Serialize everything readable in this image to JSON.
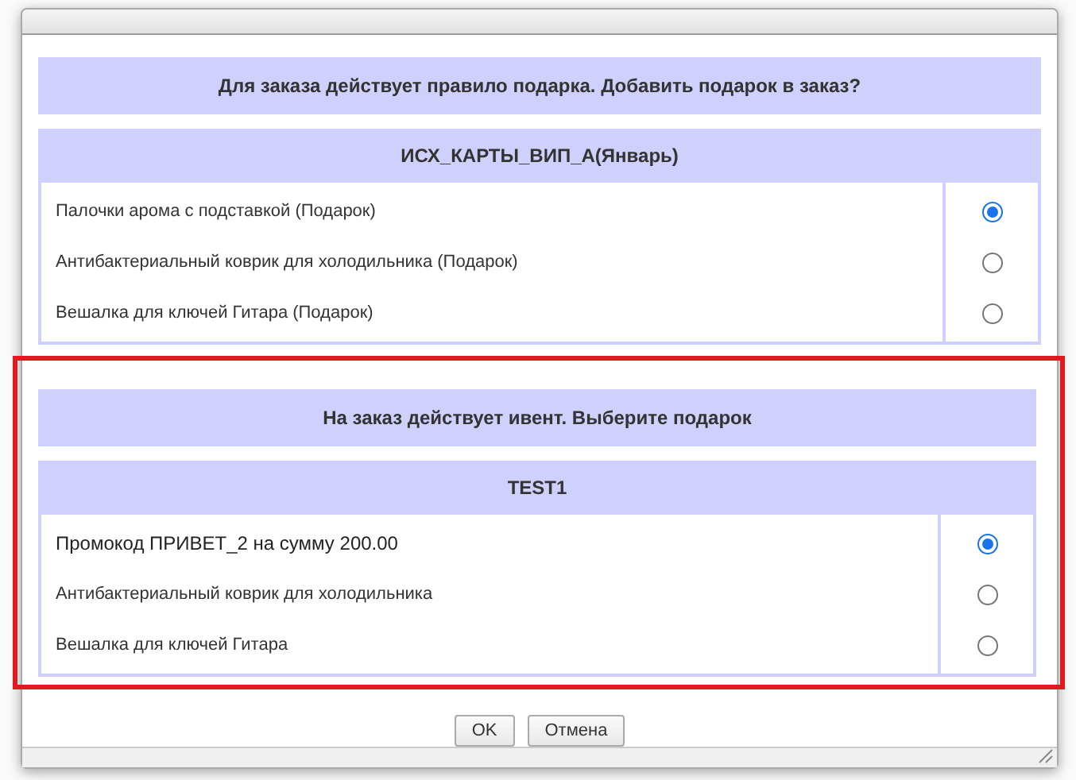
{
  "sections": [
    {
      "prompt": "Для заказа действует правило подарка. Добавить подарок в заказ?",
      "highlighted": false,
      "group": "ИСХ_КАРТЫ_ВИП_А(Январь)",
      "options": [
        {
          "label": "Палочки арома с подставкой (Подарок)",
          "selected": true
        },
        {
          "label": "Антибактериальный коврик для холодильника (Подарок)",
          "selected": false
        },
        {
          "label": "Вешалка для ключей Гитара (Подарок)",
          "selected": false
        }
      ]
    },
    {
      "prompt": "На заказ действует ивент. Выберите подарок",
      "highlighted": true,
      "group": "TEST1",
      "options": [
        {
          "label": "Промокод ПРИВЕТ_2 на сумму 200.00",
          "selected": true
        },
        {
          "label": "Антибактериальный коврик для холодильника",
          "selected": false
        },
        {
          "label": "Вешалка для ключей Гитара",
          "selected": false
        }
      ]
    }
  ],
  "buttons": [
    "OK",
    "Отмена"
  ]
}
